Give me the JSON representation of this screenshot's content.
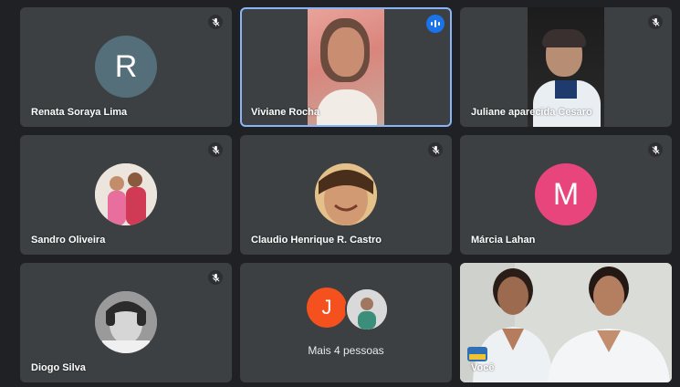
{
  "colors": {
    "background": "#202124",
    "tile": "#3c4043",
    "active_border": "#8ab4f8",
    "speaking_badge": "#1a73e8",
    "avatar_r": "#546e7a",
    "avatar_m": "#e8457c",
    "avatar_j": "#f4511e"
  },
  "participants": [
    {
      "name": "Renata Soraya Lima",
      "initial": "R",
      "muted": true,
      "icon": "mic-off-icon"
    },
    {
      "name": "Viviane Rocha",
      "muted": false,
      "speaking": true,
      "icon": "speaking-indicator-icon"
    },
    {
      "name": "Juliane aparecida Cesaro",
      "muted": true,
      "icon": "mic-off-icon"
    },
    {
      "name": "Sandro Oliveira",
      "muted": true,
      "icon": "mic-off-icon"
    },
    {
      "name": "Claudio Henrique R. Castro",
      "muted": true,
      "icon": "mic-off-icon"
    },
    {
      "name": "Márcia Lahan",
      "initial": "M",
      "muted": true,
      "icon": "mic-off-icon"
    },
    {
      "name": "Diogo Silva",
      "muted": true,
      "icon": "mic-off-icon"
    }
  ],
  "more": {
    "label": "Mais 4 pessoas",
    "initial": "J"
  },
  "self": {
    "label": "Você"
  }
}
